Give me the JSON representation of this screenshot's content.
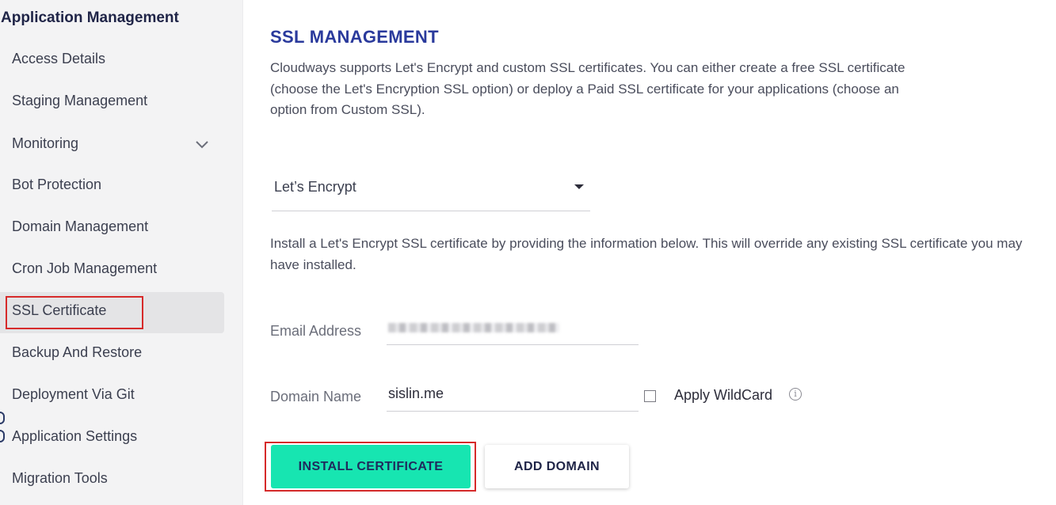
{
  "sidebar": {
    "title": "Application Management",
    "items": [
      {
        "label": "Access Details"
      },
      {
        "label": "Staging Management"
      },
      {
        "label": "Monitoring"
      },
      {
        "label": "Bot Protection"
      },
      {
        "label": "Domain Management"
      },
      {
        "label": "Cron Job Management"
      },
      {
        "label": "SSL Certificate"
      },
      {
        "label": "Backup And Restore"
      },
      {
        "label": "Deployment Via Git"
      },
      {
        "label": "Application Settings"
      },
      {
        "label": "Migration Tools"
      }
    ],
    "active_item": "SSL Certificate"
  },
  "main": {
    "title": "SSL MANAGEMENT",
    "description": "Cloudways supports Let's Encrypt and custom SSL certificates. You can either create a free SSL certificate (choose the Let's Encryption SSL option) or deploy a Paid SSL certificate for your applications (choose an option from Custom SSL).",
    "ssl_type": {
      "selected": "Let’s Encrypt"
    },
    "info_text": "Install a Let's Encrypt SSL certificate by providing the information below. This will override any existing SSL certificate you may have installed.",
    "email": {
      "label": "Email Address",
      "value": ""
    },
    "domain": {
      "label": "Domain Name",
      "value": "sislin.me"
    },
    "wildcard": {
      "label": "Apply WildCard",
      "checked": false
    },
    "buttons": {
      "install": "INSTALL CERTIFICATE",
      "add_domain": "ADD DOMAIN"
    }
  },
  "icons": {
    "chevron": "chevron-down-icon",
    "info": "info-icon",
    "caret": "caret-down-icon"
  },
  "colors": {
    "accent": "#17e5b1",
    "title": "#2a3a9c",
    "highlight": "#d62a2a"
  }
}
